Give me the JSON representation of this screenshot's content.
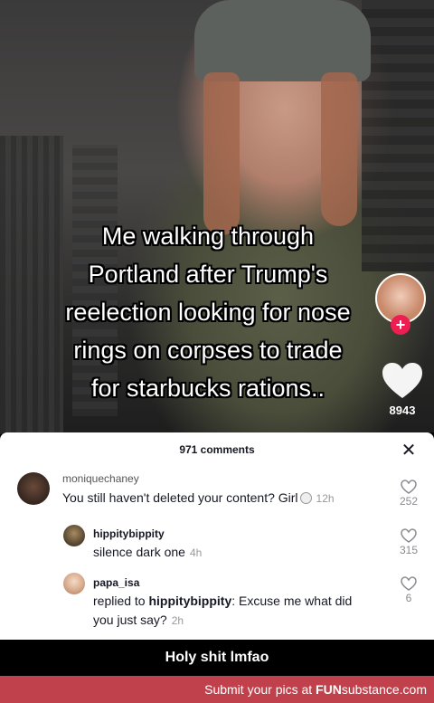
{
  "video": {
    "caption": "Me walking through\nPortland after Trump's\nreelection looking for  nose\nrings on corpses to trade\nfor starbucks rations..",
    "like_count": "8943",
    "follow_symbol": "+"
  },
  "comments_sheet": {
    "title": "971 comments",
    "close_symbol": "✕",
    "comments": [
      {
        "username": "moniquechaney",
        "text": "You still haven't deleted your content? Girl",
        "time": "12h",
        "likes": "252"
      },
      {
        "username": "hippitybippity",
        "text": "silence dark one",
        "time": "4h",
        "likes": "315"
      },
      {
        "username": "papa_isa",
        "text_prefix": "replied to ",
        "mention": "hippitybippity",
        "text_suffix": ": Excuse me what did",
        "text_line2": "you just say?",
        "time": "2h",
        "likes": "6"
      }
    ]
  },
  "banner": {
    "text": "Holy shit lmfao"
  },
  "footer": {
    "prefix": "Submit your pics at ",
    "brand_bold": "FUN",
    "brand_rest": "substance.com"
  },
  "colors": {
    "follow_red": "#ee1d52",
    "footer_red": "#c0414b"
  }
}
